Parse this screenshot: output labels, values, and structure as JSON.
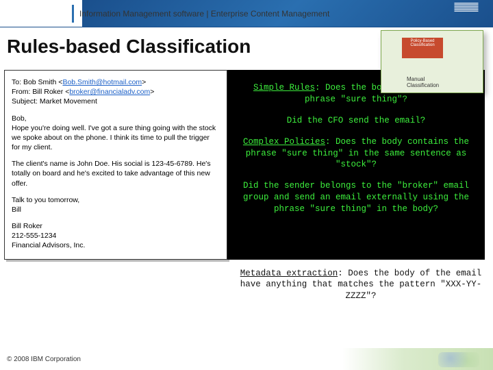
{
  "header": {
    "breadcrumb": "Information Management software | Enterprise Content Management",
    "logo_name": "ibm-logo"
  },
  "callout": {
    "badge": "Policy-Based Classification",
    "label": "Manual Classification"
  },
  "title": "Rules-based Classification",
  "email": {
    "to_label": "To: ",
    "to_name": "Bob Smith",
    "to_addr": "Bob.Smith@hotmail.com",
    "from_label": "From: ",
    "from_name": "Bill Roker",
    "from_addr": "broker@financialadv.com",
    "subject_label": "Subject: ",
    "subject_value": "Market Movement",
    "para1": "Bob,\nHope you're doing well. I've got a sure thing going with the stock we spoke about on the phone. I think its time to pull the trigger for my client.",
    "para2": "The client's name is John Doe. His social is 123-45-6789. He's totally on board and he's excited to take advantage of this new offer.",
    "para3": "Talk to you tomorrow,\nBill",
    "sig1": "Bill Roker",
    "sig2": "212-555-1234",
    "sig3": "Financial Advisors, Inc."
  },
  "rules": {
    "simple_lead": "Simple Rules",
    "simple_body": ": Does the body contains the phrase \"sure thing\"?",
    "simple2": "Did the CFO send the email?",
    "complex_lead": "Complex Policies",
    "complex_body": ": Does the body contains the phrase \"sure thing\" in the same sentence as \"stock\"?",
    "complex2": "Did the sender belongs to the \"broker\" email group and send an email externally using the phrase \"sure thing\" in the body?",
    "meta_lead": "Metadata extraction",
    "meta_body": ": Does the body of the email have anything that matches the pattern \"XXX-YY-ZZZZ\"?"
  },
  "footer": "© 2008 IBM Corporation"
}
